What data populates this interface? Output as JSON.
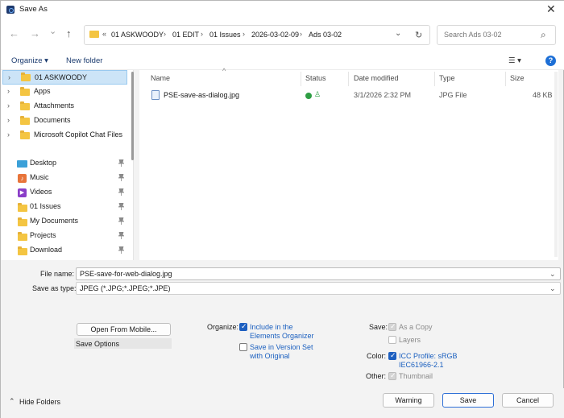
{
  "window": {
    "title": "Save As",
    "close_glyph": "✕"
  },
  "nav": {
    "back_glyph": "←",
    "forward_glyph": "→",
    "recent_glyph": "⌄",
    "up_glyph": "↑",
    "breadcrumb_prefix": "«",
    "breadcrumbs": [
      "01 ASKWOODY",
      "01 EDIT",
      "01 Issues",
      "2026-03-02-09",
      "Ads 03-02"
    ],
    "separator": "›",
    "dropdown_glyph": "⌄",
    "refresh_glyph": "↻",
    "search_placeholder": "Search Ads 03-02",
    "search_glyph": "⌕"
  },
  "toolbar": {
    "organize_label": "Organize ▾",
    "new_folder_label": "New folder",
    "view_glyph": "☰ ▾",
    "help_glyph": "?"
  },
  "sidebar": {
    "chevron": "›",
    "pin_glyph": "📌",
    "items": [
      {
        "label": "01 ASKWOODY",
        "icon": "folder-icon",
        "selected": true,
        "pinned": false
      },
      {
        "label": "Apps",
        "icon": "folder-icon",
        "pinned": false
      },
      {
        "label": "Attachments",
        "icon": "folder-icon",
        "pinned": false
      },
      {
        "label": "Documents",
        "icon": "folder-icon",
        "pinned": false
      },
      {
        "label": "Microsoft Copilot Chat Files",
        "icon": "folder-icon",
        "pinned": false
      },
      {
        "label": "Desktop",
        "icon": "desktop-icon",
        "pinned": true
      },
      {
        "label": "Music",
        "icon": "music-icon",
        "pinned": true
      },
      {
        "label": "Videos",
        "icon": "videos-icon",
        "pinned": true
      },
      {
        "label": "01 Issues",
        "icon": "folder-icon",
        "pinned": true
      },
      {
        "label": "My Documents",
        "icon": "folder-icon",
        "pinned": true
      },
      {
        "label": "Projects",
        "icon": "folder-icon",
        "pinned": true
      },
      {
        "label": "Download",
        "icon": "folder-icon",
        "pinned": true
      }
    ]
  },
  "filelist": {
    "sort_glyph": "^",
    "columns": [
      "Name",
      "Status",
      "Date modified",
      "Type",
      "Size"
    ],
    "rows": [
      {
        "name": "PSE-save-as-dialog.jpg",
        "status": "synced",
        "date": "3/1/2026 2:32 PM",
        "type": "JPG File",
        "size": "48 KB"
      }
    ]
  },
  "form": {
    "file_name_label": "File name:",
    "file_name_value": "PSE-save-for-web-dialog.jpg",
    "save_as_type_label": "Save as type:",
    "save_as_type_value": "JPEG (*.JPG;*.JPEG;*.JPE)",
    "chevron": "⌄"
  },
  "options": {
    "open_from_mobile_label": "Open From Mobile...",
    "save_options_label": "Save Options",
    "organize_label": "Organize:",
    "include_organizer_label": "Include in the Elements Organizer",
    "include_organizer_line1": "Include in the",
    "include_organizer_line2": "Elements Organizer",
    "include_organizer_checked": true,
    "version_set_line1": "Save in Version Set",
    "version_set_line2": "with Original",
    "version_set_checked": false,
    "save_label": "Save:",
    "as_copy_label": "As a Copy",
    "layers_label": "Layers",
    "color_label": "Color:",
    "icc_line1": "ICC Profile:  sRGB",
    "icc_line2": "IEC61966-2.1",
    "icc_checked": true,
    "other_label": "Other:",
    "thumbnail_label": "Thumbnail"
  },
  "footer": {
    "hide_folders_label": "Hide Folders",
    "hide_folders_glyph": "⌃",
    "warning_label": "Warning",
    "save_button_label": "Save",
    "cancel_label": "Cancel"
  },
  "colors": {
    "accent": "#1d5fc0",
    "selected_bg": "#cce4f7",
    "folder": "#f4c542",
    "status_ok": "#2e9e44"
  }
}
